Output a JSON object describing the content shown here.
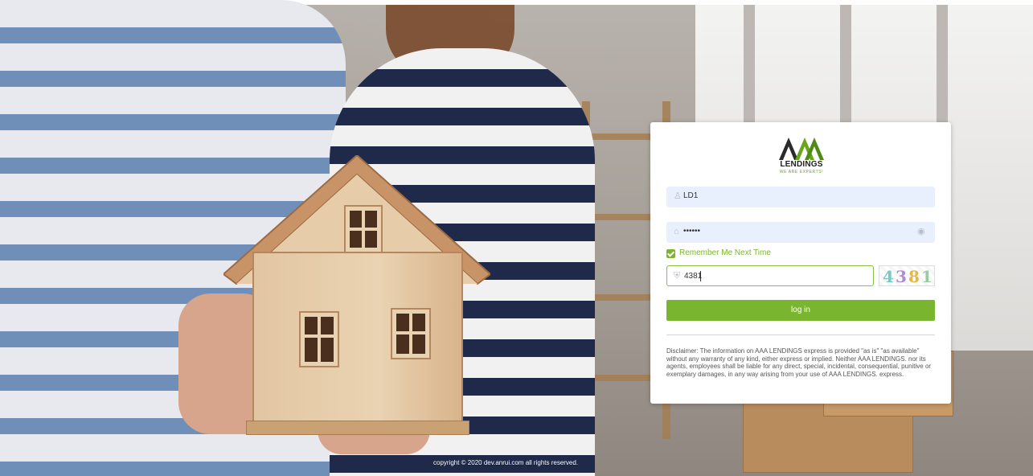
{
  "top_fragment": {
    "prefix": "",
    "link": ""
  },
  "brand": {
    "logo_word": "LENDINGS",
    "logo_tagline": "WE ARE EXPERTS!"
  },
  "login": {
    "username_value": "LD1",
    "password_mask": "••••••",
    "remember_label": "Remember Me Next Time",
    "remember_checked": true,
    "captcha_value": "4381",
    "captcha_image_text": "4381",
    "login_button_label": "log in"
  },
  "disclaimer": "Disclaimer: The information on AAA LENDINGS express is provided \"as is\" \"as available\" without any warranty of any kind, either express or implied. Neither AAA LENDINGS. nor its agents, employees shall be liable for any direct, special, incidental, consequential, punitive or exemplary damages, in any way arising from your use of AAA LENDINGS. express.",
  "footer": {
    "copyright": "copyright © 2020 dev.anrui.com all rights reserved."
  },
  "colors": {
    "accent_green": "#7ab52f",
    "field_bg": "#e8f0fe"
  },
  "icons": {
    "username": "user-icon",
    "password": "lock-icon",
    "password_toggle": "eye-icon",
    "captcha": "shield-icon"
  }
}
